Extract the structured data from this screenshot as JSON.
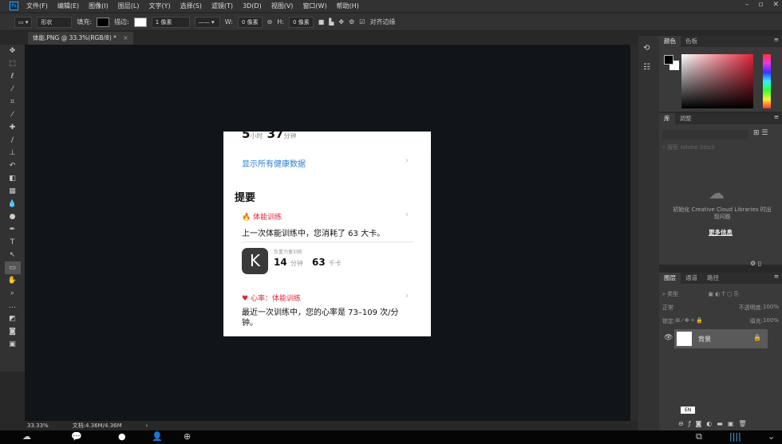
{
  "app": {
    "logo": "Ps"
  },
  "menu": [
    "文件(F)",
    "编辑(E)",
    "图像(I)",
    "图层(L)",
    "文字(Y)",
    "选择(S)",
    "滤镜(T)",
    "3D(D)",
    "视图(V)",
    "窗口(W)",
    "帮助(H)"
  ],
  "window_controls": [
    "–",
    "▫",
    "✕"
  ],
  "options": {
    "mode": "形状",
    "fill_label": "填充:",
    "stroke_label": "描边:",
    "stroke_width": "1 像素",
    "w_label": "W:",
    "w_value": "0 像素",
    "h_label": "H:",
    "h_value": "0 像素",
    "align_edges": "对齐边缘"
  },
  "tab": {
    "title": "体能.PNG @ 33.3%(RGB/8) *",
    "close": "×"
  },
  "document": {
    "duration_hours": "5",
    "hours_unit": "小时",
    "duration_min": "37",
    "min_unit": "分钟",
    "show_all": "显示所有健康数据",
    "summary_title": "提要",
    "card1": {
      "category": "体能训练",
      "text": "上一次体能训练中，您消耗了 63 大卡。",
      "app_caption": "负重力量训练",
      "minutes": "14",
      "minutes_unit": "分钟",
      "kcal": "63",
      "kcal_unit": "千卡"
    },
    "card2": {
      "category": "心率：体能训练",
      "text": "最近一次训练中，您的心率是 73–109 次/分钟。"
    }
  },
  "status": {
    "zoom": "33.33%",
    "doc_size": "文档:4.36M/4.36M",
    "arrow": "›"
  },
  "color_panel": {
    "tabs": [
      "颜色",
      "色板"
    ]
  },
  "library_panel": {
    "tabs": [
      "库",
      "调整"
    ],
    "search_placeholder": "搜索 Adobe Stock",
    "message": "初始化 Creative Cloud Libraries 时出现问题",
    "more_info": "更多信息"
  },
  "layers_panel": {
    "tabs": [
      "图层",
      "通道",
      "路径"
    ],
    "filter": "类型",
    "blend": "正常",
    "opacity_label": "不透明度:",
    "opacity": "100%",
    "lock_label": "锁定:",
    "fill_label": "填充:",
    "fill": "100%",
    "layers": [
      {
        "name": "背景",
        "visible": true,
        "locked": true
      }
    ]
  },
  "ime": "EN",
  "colors": {
    "accent_red": "#e0243a",
    "link_blue": "#2d7fd8",
    "canvas_bg": "#111419"
  }
}
